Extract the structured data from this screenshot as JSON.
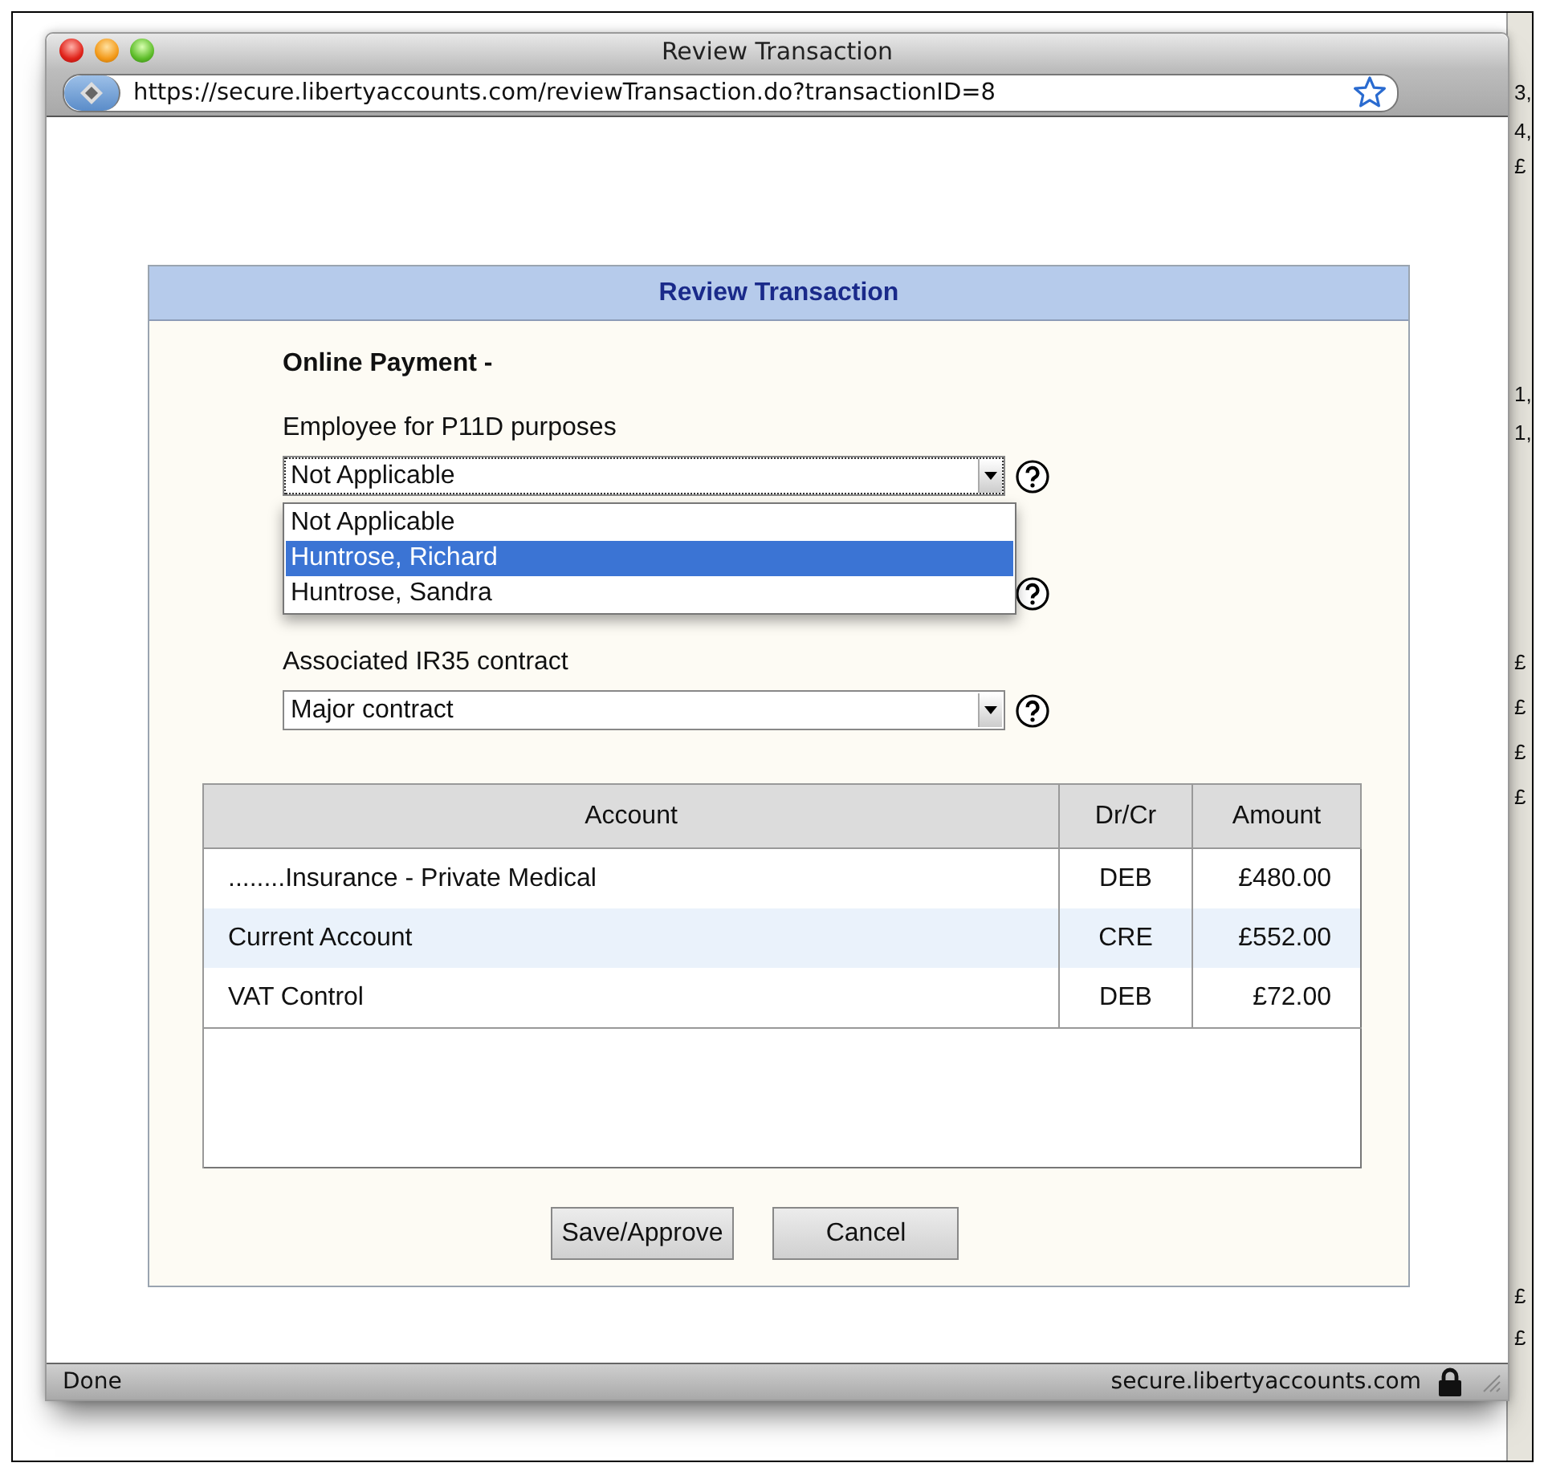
{
  "window": {
    "title": "Review Transaction",
    "url": "https://secure.libertyaccounts.com/reviewTransaction.do?transactionID=8"
  },
  "dialog": {
    "title": "Review Transaction",
    "heading": "Online Payment -",
    "fields": [
      {
        "kind": "select",
        "label": "Employee for P11D purposes",
        "value": "Not Applicable",
        "open": true,
        "options": [
          {
            "label": "Not Applicable",
            "highlighted": false
          },
          {
            "label": "Huntrose, Richard",
            "highlighted": true
          },
          {
            "label": "Huntrose, Sandra",
            "highlighted": false
          }
        ]
      },
      {
        "kind": "covered"
      },
      {
        "kind": "select",
        "label": "Associated IR35 contract",
        "value": "Major contract",
        "open": false
      }
    ],
    "table": {
      "columns": [
        "Account",
        "Dr/Cr",
        "Amount"
      ],
      "rows": [
        {
          "cells": [
            "........Insurance - Private Medical",
            "DEB",
            "£480.00"
          ],
          "selected": false
        },
        {
          "cells": [
            "Current Account",
            "CRE",
            "£552.00"
          ],
          "selected": true
        },
        {
          "cells": [
            "VAT Control",
            "DEB",
            "£72.00"
          ],
          "selected": false
        }
      ]
    },
    "buttons": [
      "Save/Approve",
      "Cancel"
    ]
  },
  "status_bar": {
    "text": "Done",
    "host": "secure.libertyaccounts.com"
  },
  "background_page": [
    "3,",
    "4,",
    "£",
    "1,",
    "1,",
    "£",
    "£",
    "£",
    "£",
    "£",
    "£"
  ]
}
